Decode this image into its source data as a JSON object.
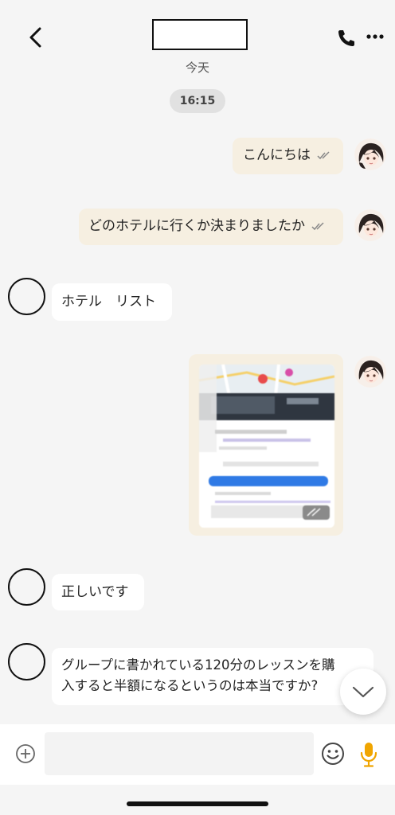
{
  "header": {
    "title": "",
    "date_label": "今天",
    "time_divider": "16:15"
  },
  "messages": [
    {
      "side": "sent",
      "text": "こんにちは"
    },
    {
      "side": "sent",
      "text": "どのホテルに行くか決まりましたか"
    },
    {
      "side": "received",
      "text": "ホテル　リスト"
    },
    {
      "side": "sent",
      "type": "image"
    },
    {
      "side": "received",
      "text": "正しいです"
    },
    {
      "side": "received",
      "line1": "グループに書かれている120分のレッスンを購",
      "line2": "入すると半額になるというのは本当ですか?"
    }
  ],
  "input": {
    "placeholder": ""
  },
  "icons": {
    "back": "chevron-left-icon",
    "call": "phone-icon",
    "menu": "more-dots-icon",
    "attach": "plus-circle-icon",
    "emoji": "emoji-icon",
    "voice": "microphone-icon",
    "scroll": "chevron-down-icon"
  },
  "colors": {
    "sent_bubble": "#f6efe1",
    "received_bubble": "#ffffff",
    "mic_accent": "#f0a500",
    "background": "#f5f5f5"
  }
}
